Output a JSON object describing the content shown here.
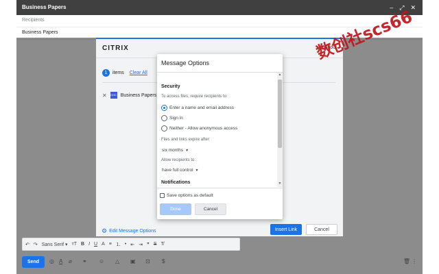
{
  "compose": {
    "title": "Business Papers",
    "recipients_placeholder": "Recipients",
    "subject": "Business Papers"
  },
  "citrix": {
    "logo": "CITRIX",
    "logout": "Logout",
    "item_count": "1",
    "items_label": "items",
    "clear_all": "Clear All",
    "file_name": "Business Papers",
    "file_icon_label": "DOC",
    "edit_options": "Edit Message Options",
    "insert_link": "Insert Link",
    "cancel": "Cancel"
  },
  "modal": {
    "title": "Message Options",
    "security_heading": "Security",
    "access_label": "To access files, require recipients to:",
    "access_options": [
      {
        "label": "Enter a name and email address",
        "selected": true
      },
      {
        "label": "Sign in",
        "selected": false
      },
      {
        "label": "Neither - Allow anonymous access",
        "selected": false
      }
    ],
    "expire_label": "Files and links expire after:",
    "expire_value": "six months",
    "allow_label": "Allow recipients to:",
    "allow_value": "have full control",
    "notifications_heading": "Notifications",
    "save_default": "Save options as default",
    "done": "Done",
    "cancel": "Cancel"
  },
  "toolbar": {
    "undo": "↶",
    "redo": "↷",
    "font": "Sans Serif",
    "size": "тT",
    "bold": "B",
    "italic": "I",
    "underline": "U",
    "color": "A",
    "align": "≡",
    "numbered": "⒈",
    "bulleted": "•",
    "indent_less": "⇤",
    "indent_more": "⇥",
    "quote": "❞",
    "strike": "S",
    "clear": "T̸"
  },
  "bottom": {
    "send": "Send"
  },
  "watermark": "数创社scs66",
  "colors": {
    "accent": "#1a73e8",
    "header": "#404040",
    "watermark": "#c0151b"
  }
}
